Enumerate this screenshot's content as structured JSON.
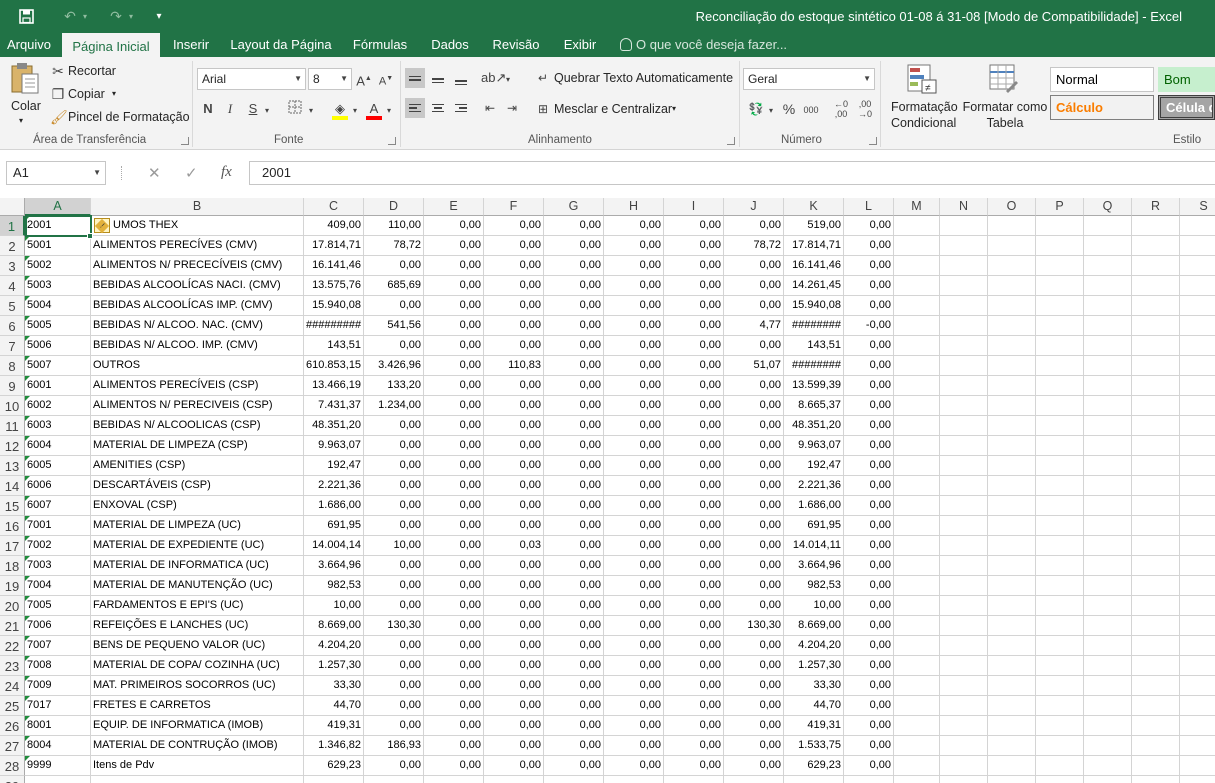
{
  "window": {
    "title": "Reconciliação do estoque sintético 01-08 á 31-08  [Modo de Compatibilidade] - Excel"
  },
  "qat": {
    "save_icon": "save-icon",
    "undo_icon": "undo-icon",
    "redo_icon": "redo-icon",
    "customize_icon": "customize-qat-icon"
  },
  "tabs": [
    "Arquivo",
    "Página Inicial",
    "Inserir",
    "Layout da Página",
    "Fórmulas",
    "Dados",
    "Revisão",
    "Exibir"
  ],
  "tell_me": "O que você deseja fazer...",
  "ribbon": {
    "clipboard": {
      "paste": "Colar",
      "cut": "Recortar",
      "copy": "Copiar",
      "format_painter": "Pincel de Formatação",
      "label": "Área de Transferência"
    },
    "font": {
      "name": "Arial",
      "size": "8",
      "bold": "N",
      "italic": "I",
      "underline": "S",
      "label": "Fonte",
      "fill_color": "#ffff00",
      "font_color": "#ff0000"
    },
    "alignment": {
      "wrap": "Quebrar Texto Automaticamente",
      "merge": "Mesclar e Centralizar",
      "label": "Alinhamento"
    },
    "number": {
      "format": "Geral",
      "label": "Número"
    },
    "styles": {
      "conditional": "Formatação Condicional",
      "as_table": "Formatar como Tabela",
      "normal": "Normal",
      "good": "Bom",
      "calc": "Cálculo",
      "check": "Célula de",
      "label": "Estilo"
    }
  },
  "formula_bar": {
    "name_box": "A1",
    "fx": "fx",
    "value": "2001"
  },
  "columns": [
    "A",
    "B",
    "C",
    "D",
    "E",
    "F",
    "G",
    "H",
    "I",
    "J",
    "K",
    "L",
    "M",
    "N",
    "O",
    "P",
    "Q",
    "R",
    "S"
  ],
  "rows": [
    [
      "2001",
      "UMOS THEX",
      "409,00",
      "110,00",
      "0,00",
      "0,00",
      "0,00",
      "0,00",
      "0,00",
      "0,00",
      "519,00",
      "0,00"
    ],
    [
      "5001",
      "ALIMENTOS PERECÍVES (CMV)",
      "17.814,71",
      "78,72",
      "0,00",
      "0,00",
      "0,00",
      "0,00",
      "0,00",
      "78,72",
      "17.814,71",
      "0,00"
    ],
    [
      "5002",
      "ALIMENTOS N/ PRECECÍVEIS (CMV)",
      "16.141,46",
      "0,00",
      "0,00",
      "0,00",
      "0,00",
      "0,00",
      "0,00",
      "0,00",
      "16.141,46",
      "0,00"
    ],
    [
      "5003",
      "BEBIDAS ALCOOLÍCAS NACI. (CMV)",
      "13.575,76",
      "685,69",
      "0,00",
      "0,00",
      "0,00",
      "0,00",
      "0,00",
      "0,00",
      "14.261,45",
      "0,00"
    ],
    [
      "5004",
      "BEBIDAS ALCOOLÍCAS IMP. (CMV)",
      "15.940,08",
      "0,00",
      "0,00",
      "0,00",
      "0,00",
      "0,00",
      "0,00",
      "0,00",
      "15.940,08",
      "0,00"
    ],
    [
      "5005",
      "BEBIDAS N/ ALCOO. NAC. (CMV)",
      "#########",
      "541,56",
      "0,00",
      "0,00",
      "0,00",
      "0,00",
      "0,00",
      "4,77",
      "########",
      "-0,00"
    ],
    [
      "5006",
      "BEBIDAS N/ ALCOO. IMP. (CMV)",
      "143,51",
      "0,00",
      "0,00",
      "0,00",
      "0,00",
      "0,00",
      "0,00",
      "0,00",
      "143,51",
      "0,00"
    ],
    [
      "5007",
      "OUTROS",
      "610.853,15",
      "3.426,96",
      "0,00",
      "110,83",
      "0,00",
      "0,00",
      "0,00",
      "51,07",
      "########",
      "0,00"
    ],
    [
      "6001",
      "ALIMENTOS PERECÍVEIS (CSP)",
      "13.466,19",
      "133,20",
      "0,00",
      "0,00",
      "0,00",
      "0,00",
      "0,00",
      "0,00",
      "13.599,39",
      "0,00"
    ],
    [
      "6002",
      "ALIMENTOS N/ PERECIVEIS  (CSP)",
      "7.431,37",
      "1.234,00",
      "0,00",
      "0,00",
      "0,00",
      "0,00",
      "0,00",
      "0,00",
      "8.665,37",
      "0,00"
    ],
    [
      "6003",
      "BEBIDAS N/ ALCOOLICAS (CSP)",
      "48.351,20",
      "0,00",
      "0,00",
      "0,00",
      "0,00",
      "0,00",
      "0,00",
      "0,00",
      "48.351,20",
      "0,00"
    ],
    [
      "6004",
      "MATERIAL DE LIMPEZA (CSP)",
      "9.963,07",
      "0,00",
      "0,00",
      "0,00",
      "0,00",
      "0,00",
      "0,00",
      "0,00",
      "9.963,07",
      "0,00"
    ],
    [
      "6005",
      "AMENITIES (CSP)",
      "192,47",
      "0,00",
      "0,00",
      "0,00",
      "0,00",
      "0,00",
      "0,00",
      "0,00",
      "192,47",
      "0,00"
    ],
    [
      "6006",
      "DESCARTÁVEIS (CSP)",
      "2.221,36",
      "0,00",
      "0,00",
      "0,00",
      "0,00",
      "0,00",
      "0,00",
      "0,00",
      "2.221,36",
      "0,00"
    ],
    [
      "6007",
      "ENXOVAL (CSP)",
      "1.686,00",
      "0,00",
      "0,00",
      "0,00",
      "0,00",
      "0,00",
      "0,00",
      "0,00",
      "1.686,00",
      "0,00"
    ],
    [
      "7001",
      "MATERIAL DE LIMPEZA (UC)",
      "691,95",
      "0,00",
      "0,00",
      "0,00",
      "0,00",
      "0,00",
      "0,00",
      "0,00",
      "691,95",
      "0,00"
    ],
    [
      "7002",
      "MATERIAL DE EXPEDIENTE (UC)",
      "14.004,14",
      "10,00",
      "0,00",
      "0,03",
      "0,00",
      "0,00",
      "0,00",
      "0,00",
      "14.014,11",
      "0,00"
    ],
    [
      "7003",
      "MATERIAL DE INFORMATICA (UC)",
      "3.664,96",
      "0,00",
      "0,00",
      "0,00",
      "0,00",
      "0,00",
      "0,00",
      "0,00",
      "3.664,96",
      "0,00"
    ],
    [
      "7004",
      "MATERIAL DE MANUTENÇÃO (UC)",
      "982,53",
      "0,00",
      "0,00",
      "0,00",
      "0,00",
      "0,00",
      "0,00",
      "0,00",
      "982,53",
      "0,00"
    ],
    [
      "7005",
      "FARDAMENTOS E EPI'S (UC)",
      "10,00",
      "0,00",
      "0,00",
      "0,00",
      "0,00",
      "0,00",
      "0,00",
      "0,00",
      "10,00",
      "0,00"
    ],
    [
      "7006",
      "REFEIÇÕES E LANCHES (UC)",
      "8.669,00",
      "130,30",
      "0,00",
      "0,00",
      "0,00",
      "0,00",
      "0,00",
      "130,30",
      "8.669,00",
      "0,00"
    ],
    [
      "7007",
      "BENS DE PEQUENO VALOR (UC)",
      "4.204,20",
      "0,00",
      "0,00",
      "0,00",
      "0,00",
      "0,00",
      "0,00",
      "0,00",
      "4.204,20",
      "0,00"
    ],
    [
      "7008",
      "MATERIAL DE COPA/ COZINHA (UC)",
      "1.257,30",
      "0,00",
      "0,00",
      "0,00",
      "0,00",
      "0,00",
      "0,00",
      "0,00",
      "1.257,30",
      "0,00"
    ],
    [
      "7009",
      "MAT. PRIMEIROS SOCORROS (UC)",
      "33,30",
      "0,00",
      "0,00",
      "0,00",
      "0,00",
      "0,00",
      "0,00",
      "0,00",
      "33,30",
      "0,00"
    ],
    [
      "7017",
      "FRETES E CARRETOS",
      "44,70",
      "0,00",
      "0,00",
      "0,00",
      "0,00",
      "0,00",
      "0,00",
      "0,00",
      "44,70",
      "0,00"
    ],
    [
      "8001",
      "EQUIP. DE INFORMATICA (IMOB)",
      "419,31",
      "0,00",
      "0,00",
      "0,00",
      "0,00",
      "0,00",
      "0,00",
      "0,00",
      "419,31",
      "0,00"
    ],
    [
      "8004",
      "MATERIAL DE CONTRUÇÃO (IMOB)",
      "1.346,82",
      "186,93",
      "0,00",
      "0,00",
      "0,00",
      "0,00",
      "0,00",
      "0,00",
      "1.533,75",
      "0,00"
    ],
    [
      "9999",
      "Itens de Pdv",
      "629,23",
      "0,00",
      "0,00",
      "0,00",
      "0,00",
      "0,00",
      "0,00",
      "0,00",
      "629,23",
      "0,00"
    ]
  ]
}
